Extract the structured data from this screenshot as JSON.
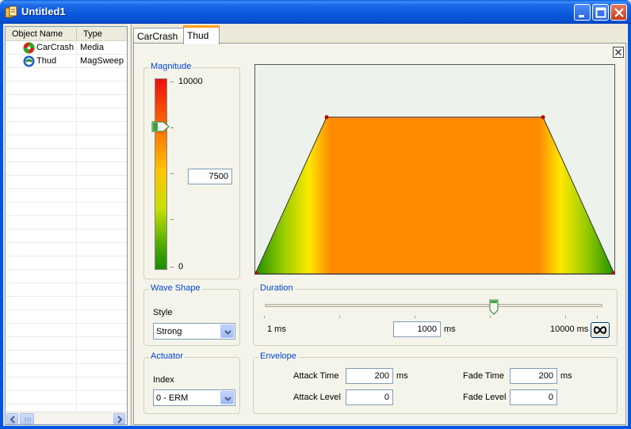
{
  "window": {
    "title": "Untitled1"
  },
  "object_list": {
    "headers": [
      "Object Name",
      "Type"
    ],
    "rows": [
      {
        "name": "CarCrash",
        "type": "Media",
        "icon": "media-icon"
      },
      {
        "name": "Thud",
        "type": "MagSweep",
        "icon": "magsweep-icon"
      }
    ]
  },
  "tabs": [
    {
      "label": "CarCrash",
      "active": false
    },
    {
      "label": "Thud",
      "active": true
    }
  ],
  "magnitude": {
    "title": "Magnitude",
    "max_label": "10000",
    "min_label": "0",
    "value": "7500",
    "level": 0.75
  },
  "wave_shape": {
    "title": "Wave Shape",
    "style_label": "Style",
    "style_value": "Strong"
  },
  "actuator": {
    "title": "Actuator",
    "index_label": "Index",
    "index_value": "0 - ERM"
  },
  "duration": {
    "title": "Duration",
    "min_label": "1 ms",
    "max_label": "10000 ms",
    "value": "1000",
    "unit": "ms",
    "slider_level": 0.68,
    "infinite_icon": "infinity-icon"
  },
  "envelope": {
    "title": "Envelope",
    "attack_time_label": "Attack Time",
    "attack_time_value": "200",
    "attack_time_unit": "ms",
    "attack_level_label": "Attack Level",
    "attack_level_value": "0",
    "fade_time_label": "Fade Time",
    "fade_time_value": "200",
    "fade_time_unit": "ms",
    "fade_level_label": "Fade Level",
    "fade_level_value": "0"
  },
  "colors": {
    "accent_tab": "#ff9f16",
    "group_title": "#0046d5",
    "effect_fill": "#ff8400"
  }
}
